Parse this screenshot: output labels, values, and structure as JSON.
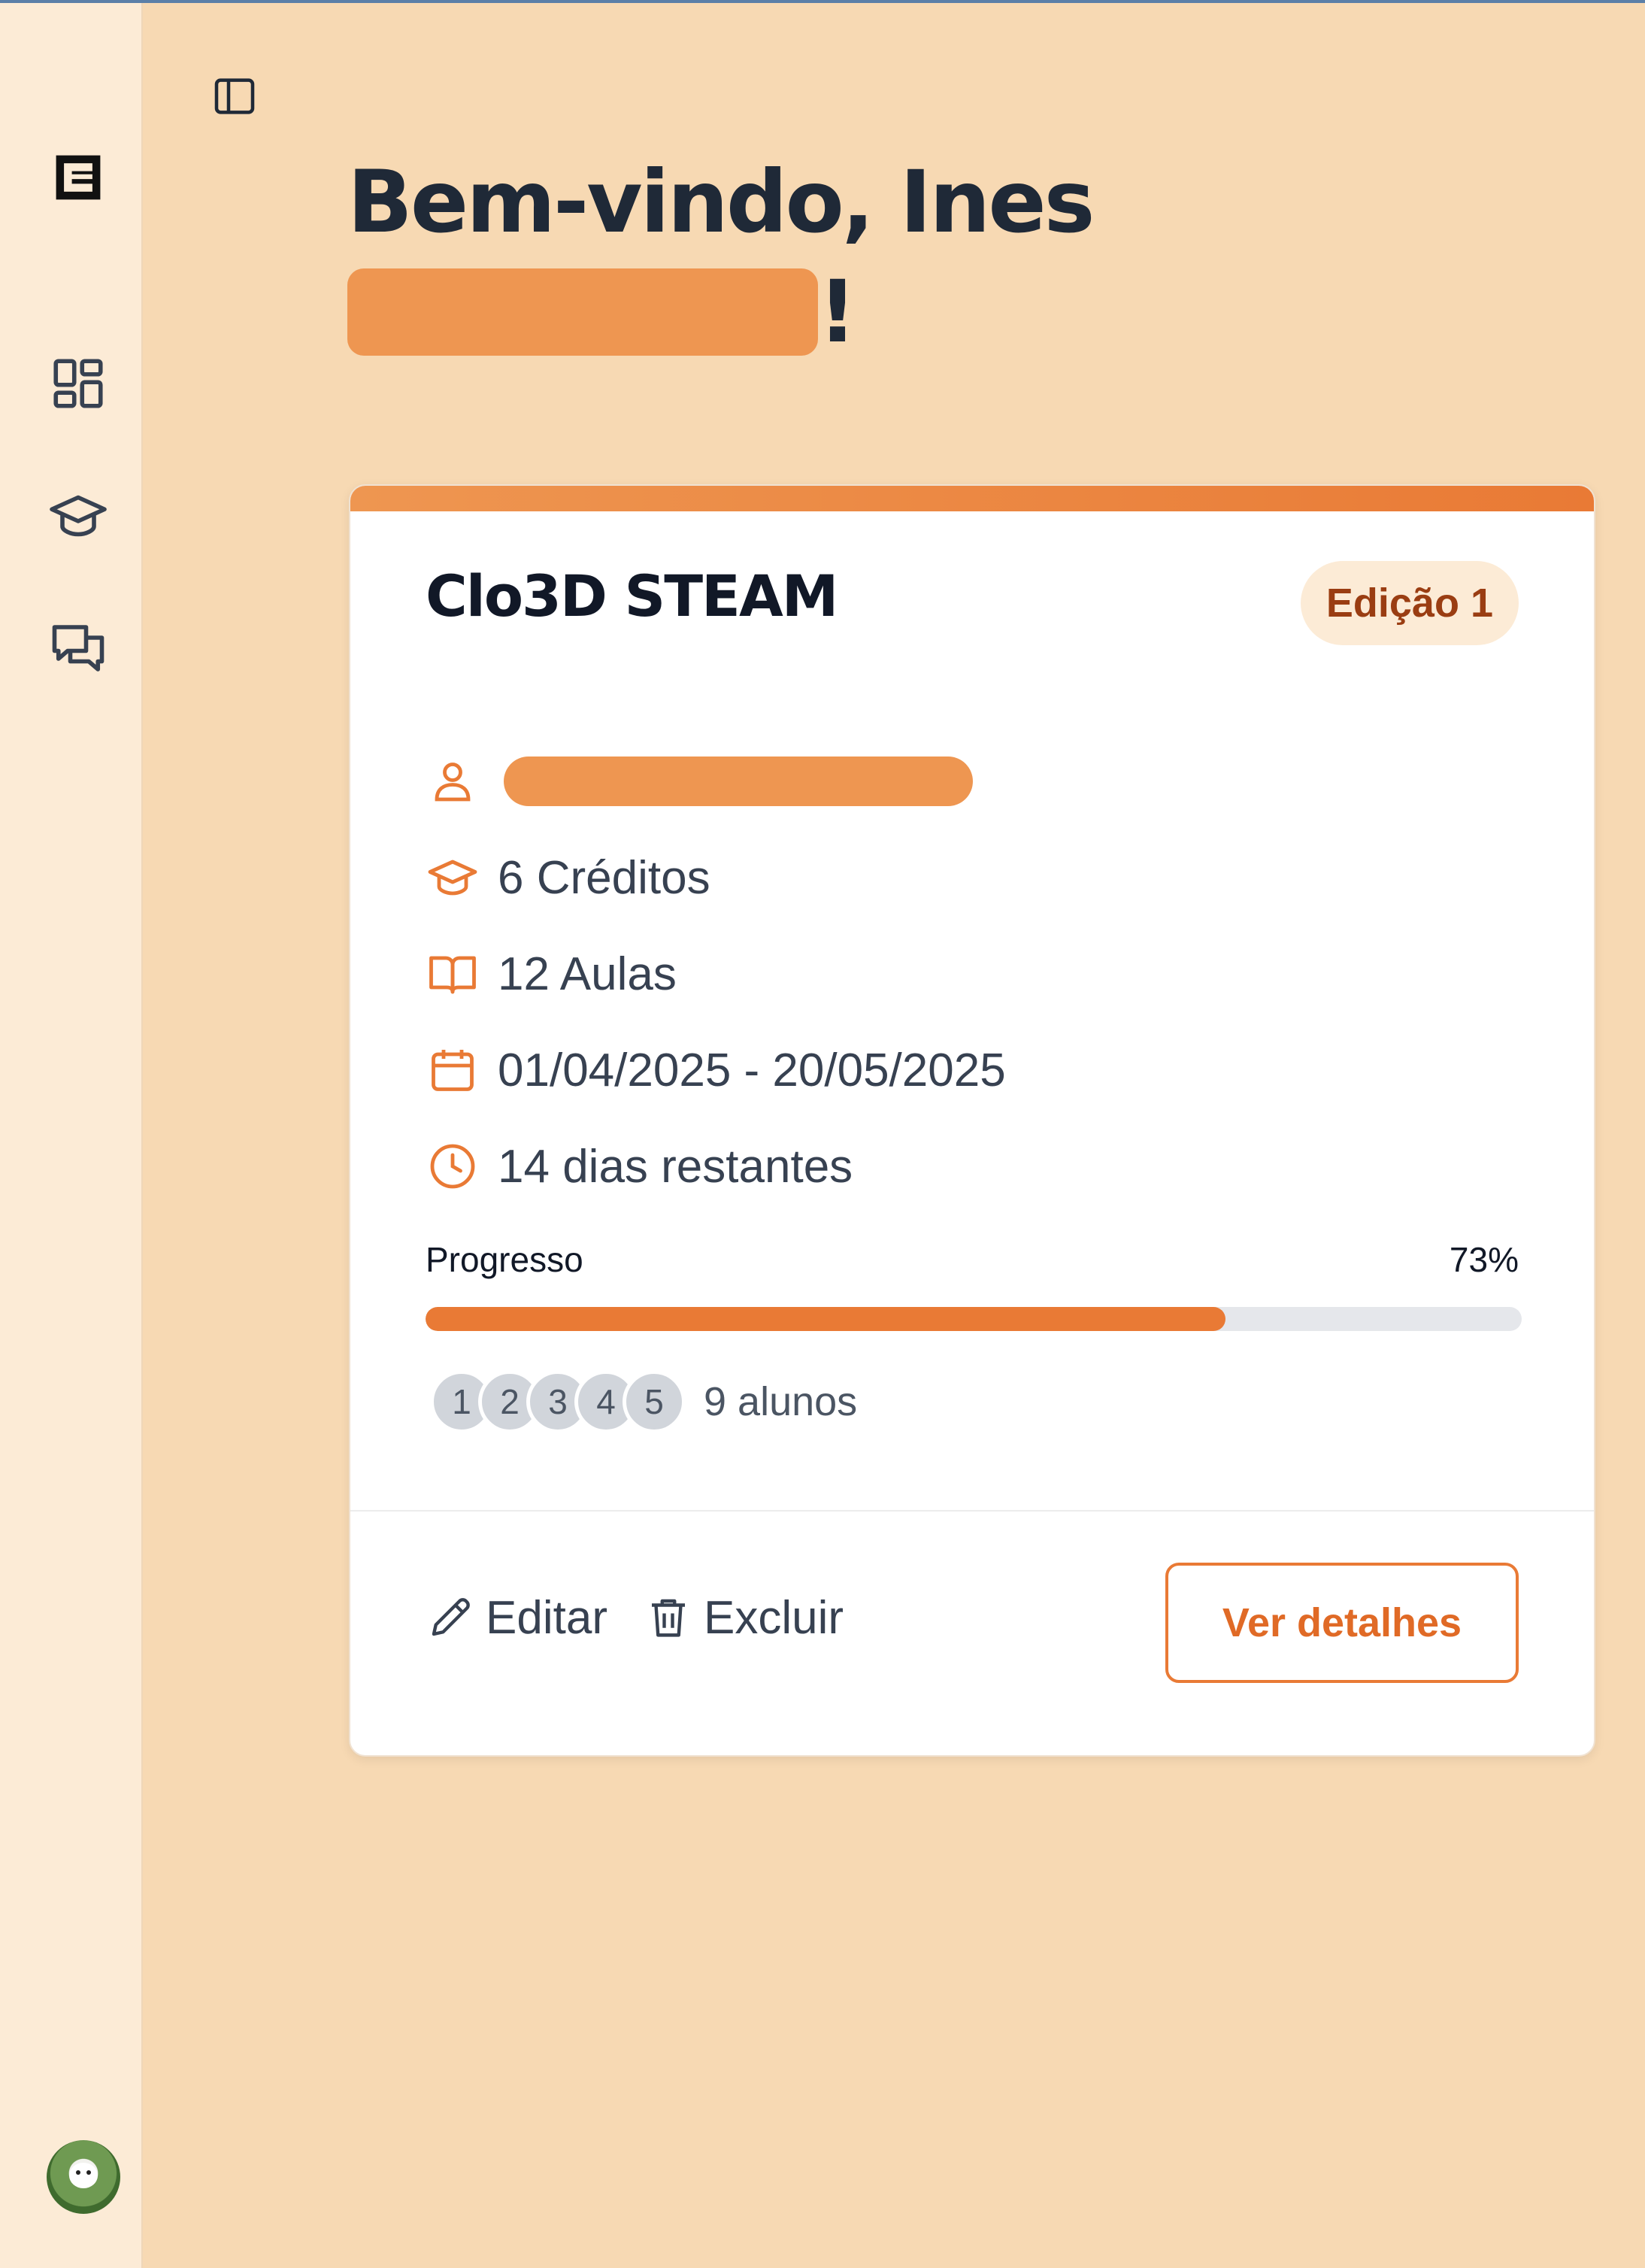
{
  "sidebar": {
    "logo_icon": "logo-icon",
    "items": [
      {
        "icon": "dashboard-icon"
      },
      {
        "icon": "graduation-cap-icon"
      },
      {
        "icon": "chat-icon"
      }
    ],
    "avatar": "user-avatar"
  },
  "header": {
    "greeting": "Bem-vindo, Ines",
    "exclamation": "!"
  },
  "course": {
    "title": "Clo3D STEAM",
    "edition": "Edição 1",
    "credits": "6 Créditos",
    "lessons": "12 Aulas",
    "dates": "01/04/2025 - 20/05/2025",
    "remaining": "14 dias restantes",
    "progress_label": "Progresso",
    "progress_text": "73%",
    "progress_value": 73,
    "students_avatars": [
      "1",
      "2",
      "3",
      "4",
      "5"
    ],
    "students_count": "9 alunos",
    "edit_label": "Editar",
    "delete_label": "Excluir",
    "details_label": "Ver detalhes"
  },
  "colors": {
    "accent": "#e97a35",
    "background": "#f7d9b3",
    "sidebar": "#fcebd6"
  }
}
